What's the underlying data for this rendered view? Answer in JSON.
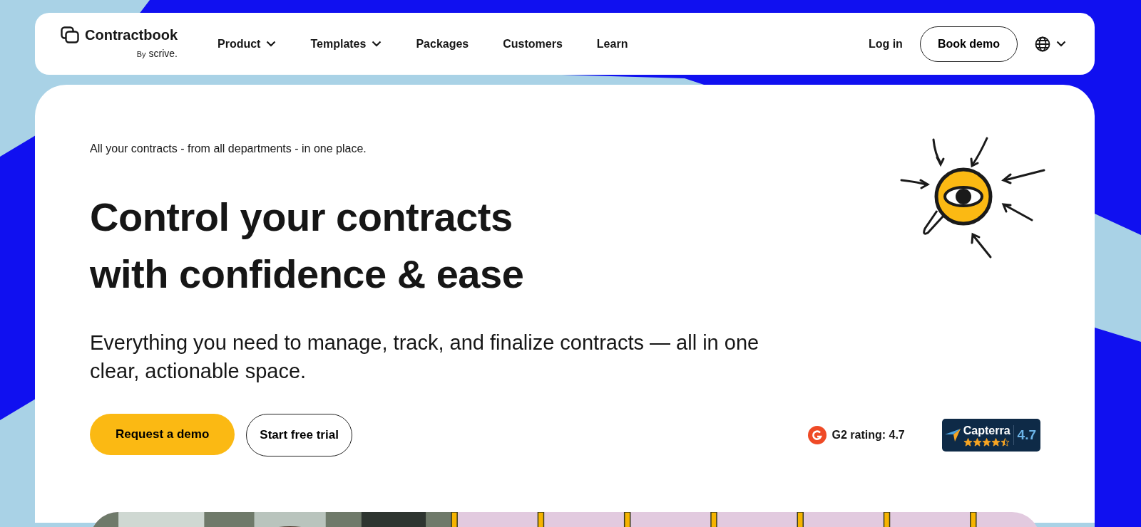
{
  "brand": {
    "name": "Contractbook",
    "byline_prefix": "By",
    "byline_name": "scrive."
  },
  "nav": [
    {
      "label": "Product",
      "has_menu": true
    },
    {
      "label": "Templates",
      "has_menu": true
    },
    {
      "label": "Packages",
      "has_menu": false
    },
    {
      "label": "Customers",
      "has_menu": false
    },
    {
      "label": "Learn",
      "has_menu": false
    }
  ],
  "login": "Log in",
  "book_demo": "Book demo",
  "hero": {
    "eyebrow": "All your contracts - from all departments - in one place.",
    "title_lines": [
      "Control your contracts",
      "with confidence & ease"
    ],
    "subtitle": "Everything you need to manage, track, and finalize contracts — all in one clear, actionable space.",
    "buttons": [
      {
        "label": "Request a demo",
        "kind": "primary"
      },
      {
        "label": "Start free trial",
        "kind": "outline"
      }
    ],
    "g2": {
      "label": "G2 rating: 4.7"
    },
    "capterra": {
      "name": "Capterra",
      "score": "4.7",
      "stars": 4.5
    }
  }
}
